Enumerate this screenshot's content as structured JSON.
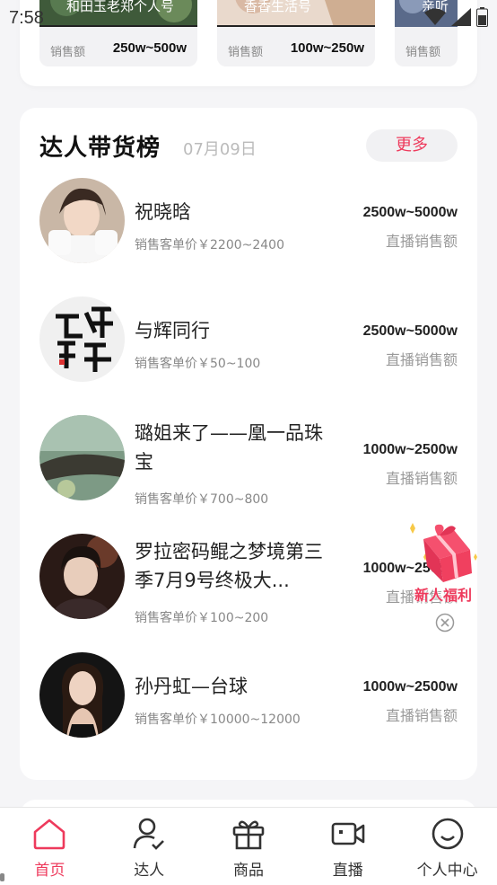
{
  "status_bar": {
    "time": "7:58"
  },
  "top_cards": [
    {
      "title": "和田玉老郑个人号",
      "stat_label": "销售额",
      "stat_value": "250w~500w"
    },
    {
      "title": "香香生活号",
      "stat_label": "销售额",
      "stat_value": "100w~250w"
    },
    {
      "title": "亲听",
      "stat_label": "销售额",
      "stat_value": ""
    }
  ],
  "ranking": {
    "title": "达人带货榜",
    "date": "07月09日",
    "more_label": "更多",
    "items": [
      {
        "name": "祝晓晗",
        "price": "销售客单价￥2200~2400",
        "sales": "2500w~5000w",
        "sales_label": "直播销售额"
      },
      {
        "name": "与辉同行",
        "price": "销售客单价￥50~100",
        "sales": "2500w~5000w",
        "sales_label": "直播销售额"
      },
      {
        "name": "璐姐来了——凰一品珠宝",
        "price": "销售客单价￥700~800",
        "sales": "1000w~2500w",
        "sales_label": "直播销售额"
      },
      {
        "name": "罗拉密码鲲之梦境第三季7月9号终极大...",
        "price": "销售客单价￥100~200",
        "sales": "1000w~2500w",
        "sales_label": "直播销售额"
      },
      {
        "name": "孙丹虹—台球",
        "price": "销售客单价￥10000~12000",
        "sales": "1000w~2500w",
        "sales_label": "直播销售额"
      }
    ]
  },
  "promo": {
    "label": "新人福利"
  },
  "tabs": [
    {
      "label": "首页",
      "icon": "home-icon",
      "active": true
    },
    {
      "label": "达人",
      "icon": "user-check-icon",
      "active": false
    },
    {
      "label": "商品",
      "icon": "gift-box-icon",
      "active": false
    },
    {
      "label": "直播",
      "icon": "video-camera-icon",
      "active": false
    },
    {
      "label": "个人中心",
      "icon": "smile-icon",
      "active": false
    }
  ],
  "colors": {
    "accent": "#ee3a5c",
    "background": "#f5f5f7"
  }
}
